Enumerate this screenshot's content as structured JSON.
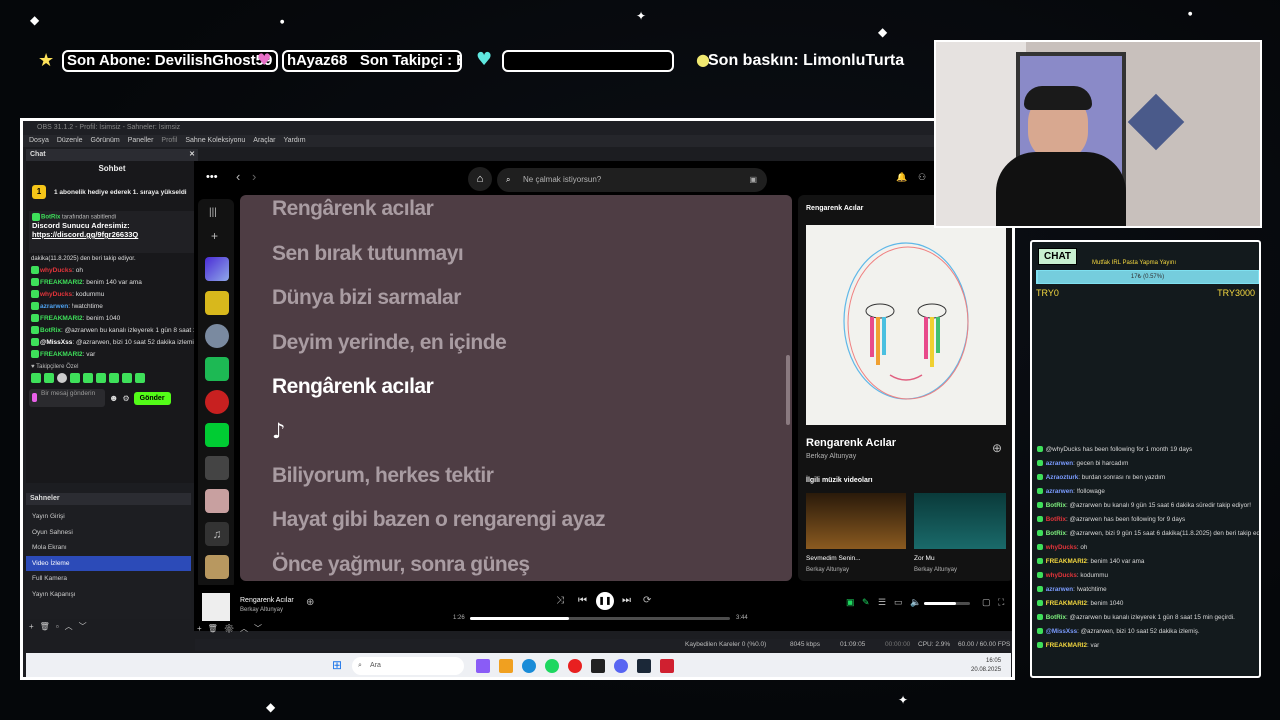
{
  "overlay": {
    "subscriber": "Son Abone: DevilishGhost59",
    "follower_tail": "hAyaz68",
    "follower_label": "Son Takipçi : Bed",
    "raid": "Son baskın: LimonluTurta"
  },
  "obs": {
    "title": "OBS 31.1.2 - Profil: İsimsiz - Sahneler: İsimsiz",
    "menu": [
      "Dosya",
      "Düzenle",
      "Görünüm",
      "Paneller",
      "Profil",
      "Sahne Koleksiyonu",
      "Araçlar",
      "Yardım"
    ],
    "chat_dock_title": "Chat",
    "chat_header": "Sohbet",
    "gift_banner": "1 abonelik hediye ederek 1. sıraya yükseldi",
    "pinned_by": "tarafından sabitlendi",
    "pinned_user": "BotRix",
    "pinned_text": "Discord Sunucu Adresimiz:",
    "pinned_link": "https://discord.gg/9fgr26633Q",
    "pinned_follow": "dakika(11.8.2025) den beri takip ediyor.",
    "messages": [
      {
        "user": "whyDucks",
        "text": ": oh",
        "color": "#e3343a"
      },
      {
        "user": "FREAKMARI2",
        "text": ": benim 140 var ama",
        "color": "#3ee05a"
      },
      {
        "user": "whyDucks",
        "text": ": kodummu",
        "color": "#e3343a"
      },
      {
        "user": "azrarwen",
        "text": ": !watchtime",
        "color": "#4ea2f0"
      },
      {
        "user": "FREAKMARI2",
        "text": ": benim 1040",
        "color": "#3ee05a"
      },
      {
        "user": "BotRix",
        "text": ": @azrarwen bu kanalı izleyerek 1 gün 8 saat 15 min geçirdi.",
        "color": "#3ee05a"
      },
      {
        "user": "@MissXss",
        "text": ": @azrarwen, bizi 10 saat 52 dakika izlemiş.",
        "color": "#ffffff"
      },
      {
        "user": "FREAKMARI2",
        "text": ": var",
        "color": "#3ee05a"
      }
    ],
    "followers_only": "Takipçilere Özel",
    "input_placeholder": "Bir mesaj gönderin",
    "send_label": "Gönder",
    "scenes_title": "Sahneler",
    "scenes": [
      "Yayın Girişi",
      "Oyun Sahnesi",
      "Mola Ekranı",
      "Video İzleme",
      "Full Kamera",
      "Yayın Kapanışı"
    ],
    "selected_scene_index": 3,
    "status": {
      "dropped": "Kaybedilen Kareler 0 (%0.0)",
      "bitrate": "8045 kbps",
      "time1": "01:09:05",
      "time2": "00:00:00",
      "cpu": "CPU: 2.9%",
      "fps": "60.00 / 60.00 FPS"
    }
  },
  "spotify": {
    "search_placeholder": "Ne çalmak istiyorsun?",
    "lyrics": [
      "Rengârenk acılar",
      "Sen bırak tutunmayı",
      "Dünya bizi sarmalar",
      "Deyim yerinde, en içinde",
      "Rengârenk acılar",
      "♪",
      "Biliyorum, herkes tektir",
      "Hayat gibi bazen o rengarengi ayaz",
      "Önce yağmur, sonra güneş"
    ],
    "active_line": 4,
    "panel_title": "Rengarenk Acılar",
    "track_title": "Rengarenk Acılar",
    "artist": "Berkay Altunyay",
    "related_title": "İlgili müzik videoları",
    "videos": [
      {
        "title": "Sevmedim Senin...",
        "artist": "Berkay Altunyay"
      },
      {
        "title": "Zor Mu",
        "artist": "Berkay Altunyay"
      }
    ],
    "now_playing": {
      "title": "Rengarenk Acılar",
      "artist": "Berkay Altunyay",
      "elapsed": "1:26",
      "duration": "3:44",
      "progress": 0.38,
      "volume": 0.7
    }
  },
  "taskbar": {
    "search": "Ara",
    "time": "16:05",
    "date": "20.08.2025"
  },
  "right_chat": {
    "title": "CHAT",
    "goal_label": "Mutfak IRL Pasta Yapma Yayını",
    "goal_progress_text": "17₺ (0.57%)",
    "goal_progress": 0.0057,
    "goal_min": "TRY0",
    "goal_max": "TRY3000",
    "messages": [
      {
        "user": "",
        "text": "@whyDucks has been following for 1 month 19 days",
        "color": "#ccc"
      },
      {
        "user": "azrarwen",
        "text": ": gecen bi harcadım",
        "color": "#7b9cff"
      },
      {
        "user": "Azraozturk",
        "text": ": burdan sonrası nı ben yazdım",
        "color": "#7b9cff"
      },
      {
        "user": "azrarwen",
        "text": ": !followage",
        "color": "#7b9cff"
      },
      {
        "user": "BotRix",
        "text": ": @azrarwen bu kanalı 9 gün 15 saat 6 dakika süredir takip ediyor!",
        "color": "#7ff07f"
      },
      {
        "user": "BotRix",
        "text": ": @azrarwen has been following for 9 days",
        "color": "#e3343a"
      },
      {
        "user": "BotRix",
        "text": ": @azrarwen, bizi 9 gün 15 saat 6 dakika(11.8.2025) den beri takip ediyor.",
        "color": "#7ff07f"
      },
      {
        "user": "whyDucks",
        "text": ": oh",
        "color": "#e3343a"
      },
      {
        "user": "FREAKMARI2",
        "text": ": benim 140 var ama",
        "color": "#f5d940"
      },
      {
        "user": "whyDucks",
        "text": ": kodummu",
        "color": "#e3343a"
      },
      {
        "user": "azrarwen",
        "text": ": !watchtime",
        "color": "#7b9cff"
      },
      {
        "user": "FREAKMARI2",
        "text": ": benim 1040",
        "color": "#f5d940"
      },
      {
        "user": "BotRix",
        "text": ": @azrarwen bu kanalı izleyerek 1 gün 8 saat 15 min geçirdi.",
        "color": "#7ff07f"
      },
      {
        "user": "@MissXss",
        "text": ": @azrarwen, bizi 10 saat 52 dakika izlemiş.",
        "color": "#7b9cff"
      },
      {
        "user": "FREAKMARI2",
        "text": ": var",
        "color": "#f5d940"
      }
    ]
  },
  "colors": {
    "spotify_green": "#1ed760",
    "lyrics_bg": "#4e3d44",
    "obs_selected": "#2c4bb8",
    "kick_green": "#53fc18",
    "goal_bar": "#7fe0f0"
  }
}
